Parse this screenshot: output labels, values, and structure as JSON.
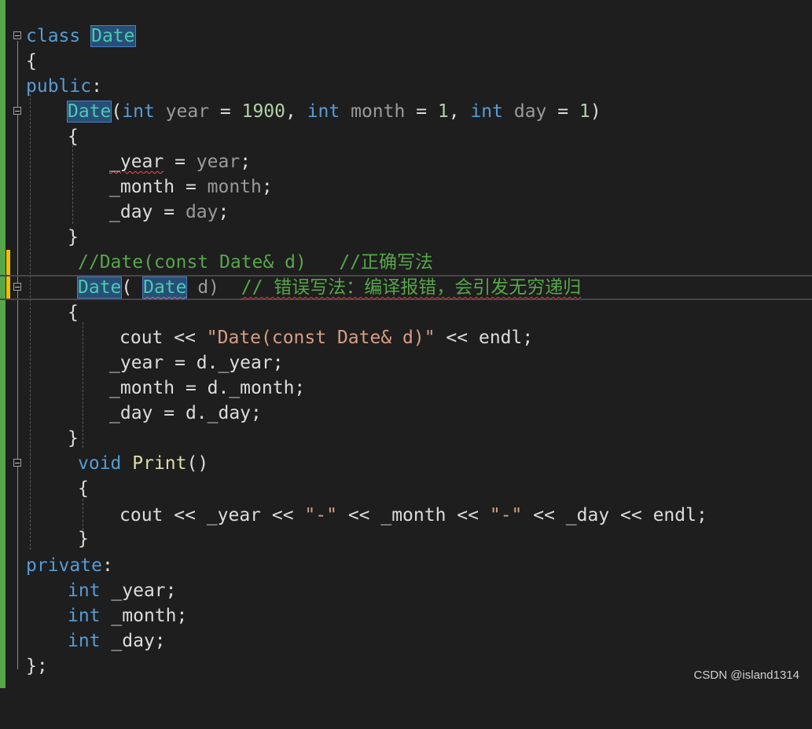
{
  "code": {
    "l1_class_kw": "class",
    "class_name": "Date",
    "l2_brace": "{",
    "l3_public": "public",
    "colon": ":",
    "l4_ctor_name": "Date",
    "l4_paren_open": "(",
    "kw_int": "int",
    "p_year": "year",
    "eq": " = ",
    "n_1900": "1900",
    "comma": ", ",
    "p_month": "month",
    "n_1": "1",
    "p_day": "day",
    "paren_close": ")",
    "brace_open": "{",
    "brace_close": "}",
    "m_year": "_year",
    "m_month": "_month",
    "m_day": "_day",
    "semi": ";",
    "l10_comment": "//Date(const Date& d)   //正确写法",
    "l11_ctor": "Date",
    "l11_open": "( ",
    "l11_type": "Date",
    "l11_param": " d)",
    "l11_comment": "// 错误写法：编译报错，会引发无穷递归",
    "cout": "cout",
    "shl": " << ",
    "str_copy": "\"Date(const Date& d)\"",
    "endl": "endl",
    "d_year": "d._year",
    "d_month": "d._month",
    "d_day": "d._day",
    "void_kw": "void",
    "print_fn": "Print",
    "empty_parens": "()",
    "str_dash": "\"-\"",
    "private_kw": "private",
    "end_brace": "};"
  },
  "watermark": "CSDN @island1314",
  "colors": {
    "keyword": "#569cd6",
    "type": "#4ec9b0",
    "function": "#dcdcaa",
    "parameter": "#9a9a9a",
    "number": "#b5cea8",
    "string": "#d69d85",
    "comment": "#57a64a",
    "margin_bar": "#57a64a",
    "highlight": "#264f78"
  }
}
